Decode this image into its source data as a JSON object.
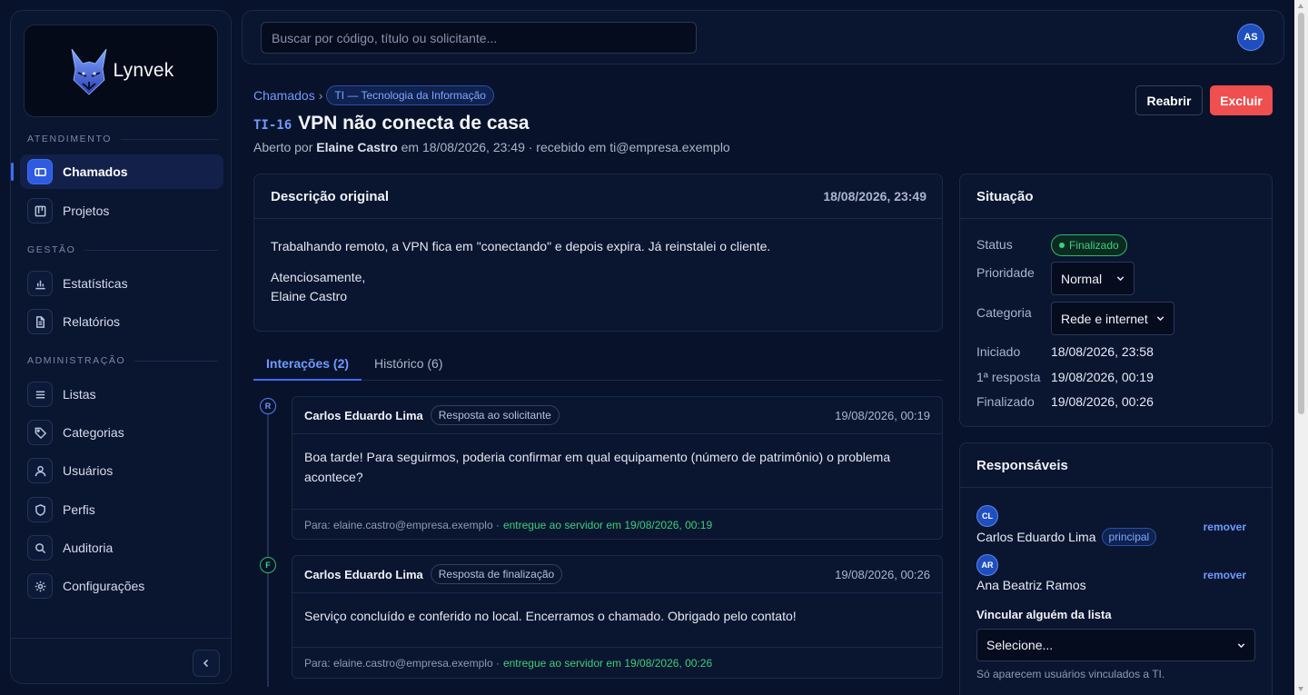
{
  "brand": {
    "name": "Lynvek"
  },
  "sidebar": {
    "sections": [
      {
        "label": "ATENDIMENTO"
      },
      {
        "label": "GESTÃO"
      },
      {
        "label": "ADMINISTRAÇÃO"
      }
    ],
    "items": [
      {
        "label": "Chamados",
        "icon": "ticket-icon",
        "active": true
      },
      {
        "label": "Projetos",
        "icon": "kanban-icon"
      },
      {
        "label": "Estatísticas",
        "icon": "bar-chart-icon"
      },
      {
        "label": "Relatórios",
        "icon": "document-icon"
      },
      {
        "label": "Listas",
        "icon": "list-icon"
      },
      {
        "label": "Categorias",
        "icon": "tag-icon"
      },
      {
        "label": "Usuários",
        "icon": "user-icon"
      },
      {
        "label": "Perfis",
        "icon": "shield-icon"
      },
      {
        "label": "Auditoria",
        "icon": "search-icon"
      },
      {
        "label": "Configurações",
        "icon": "gear-icon"
      }
    ],
    "collapse_icon": "chevron-left-icon"
  },
  "topbar": {
    "search_placeholder": "Buscar por código, título ou solicitante...",
    "user_initials": "AS"
  },
  "header": {
    "breadcrumb_root": "Chamados",
    "breadcrumb_sep": "›",
    "department": "TI — Tecnologia da Informação",
    "code": "TI-16",
    "title": "VPN não conecta de casa",
    "opened_prefix": "Aberto por",
    "opened_by": "Elaine Castro",
    "opened_suffix": "em 18/08/2026, 23:49 · recebido em ti@empresa.exemplo",
    "reopen_label": "Reabrir",
    "delete_label": "Excluir"
  },
  "description": {
    "title": "Descrição original",
    "date": "18/08/2026, 23:49",
    "line1": "Trabalhando remoto, a VPN fica em \"conectando\" e depois expira. Já reinstalei o cliente.",
    "line2": "Atenciosamente,",
    "line3": "Elaine Castro"
  },
  "tabs": [
    {
      "label": "Interações (2)",
      "active": true
    },
    {
      "label": "Histórico (6)"
    }
  ],
  "interactions": [
    {
      "marker": "R",
      "author": "Carlos Eduardo Lima",
      "badge": "Resposta ao solicitante",
      "date": "19/08/2026, 00:19",
      "body": "Boa tarde! Para seguirmos, poderia confirmar em qual equipamento (número de patrimônio) o problema acontece?",
      "to": "Para: elaine.castro@empresa.exemplo ·",
      "delivery": "entregue ao servidor em 19/08/2026, 00:19"
    },
    {
      "marker": "F",
      "author": "Carlos Eduardo Lima",
      "badge": "Resposta de finalização",
      "date": "19/08/2026, 00:26",
      "body": "Serviço concluído e conferido no local. Encerramos o chamado. Obrigado pelo contato!",
      "to": "Para: elaine.castro@empresa.exemplo ·",
      "delivery": "entregue ao servidor em 19/08/2026, 00:26"
    }
  ],
  "situation": {
    "title": "Situação",
    "status_label": "Status",
    "status_value": "Finalizado",
    "priority_label": "Prioridade",
    "priority_value": "Normal",
    "category_label": "Categoria",
    "category_value": "Rede e internet",
    "started_label": "Iniciado",
    "started_value": "18/08/2026, 23:58",
    "first_response_label": "1ª resposta",
    "first_response_value": "19/08/2026, 00:19",
    "finished_label": "Finalizado",
    "finished_value": "19/08/2026, 00:26"
  },
  "responsibles": {
    "title": "Responsáveis",
    "people": [
      {
        "initials": "CL",
        "name": "Carlos Eduardo Lima",
        "tag": "principal",
        "action": "remover"
      },
      {
        "initials": "AR",
        "name": "Ana Beatriz Ramos",
        "action": "remover"
      }
    ],
    "link_label": "Vincular alguém da lista",
    "link_select_value": "Selecione...",
    "link_hint": "Só aparecem usuários vinculados a TI."
  },
  "colors": {
    "accent": "#3b6ff5",
    "danger": "#ef4f4f",
    "success": "#3bd07c",
    "background": "#08122a"
  }
}
